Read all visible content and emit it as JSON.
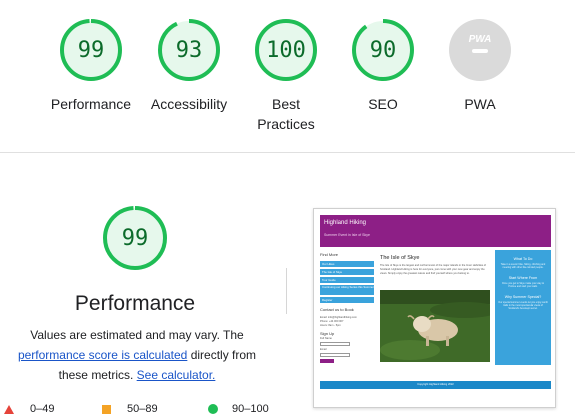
{
  "categories": [
    {
      "score": "99",
      "label": "Performance",
      "fraction": 0.99
    },
    {
      "score": "93",
      "label": "Accessibility",
      "fraction": 0.93
    },
    {
      "score": "100",
      "label": "Best Practices",
      "label_line1": "Best",
      "label_line2": "Practices",
      "fraction": 1.0
    },
    {
      "score": "90",
      "label": "SEO",
      "fraction": 0.9
    },
    {
      "score": "",
      "label": "PWA",
      "badge_text": "PWA"
    }
  ],
  "performance": {
    "score": "99",
    "fraction": 0.99,
    "title": "Performance",
    "desc_part1": "Values are estimated and may vary. The ",
    "desc_link1": "performance score is calculated",
    "desc_part2": " directly from these metrics. ",
    "desc_link2": "See calculator."
  },
  "legend": [
    {
      "range": "0–49",
      "shape": "triangle",
      "color": "#e5433a"
    },
    {
      "range": "50–89",
      "shape": "square",
      "color": "#f4a325"
    },
    {
      "range": "90–100",
      "shape": "circle",
      "color": "#1fbd55"
    }
  ],
  "colors": {
    "pass_ring": "#1fbd55",
    "pass_fill": "#e6f8ec",
    "pass_text": "#0c6b2b",
    "pwa_gray": "#dadada"
  },
  "thumbnail": {
    "site_title": "Highland Hiking",
    "site_subtitle": "Summer Event in Isle of Skye",
    "find_more": "Find More",
    "left_links": [
      "Our Hikes",
      "The Isle of Skye",
      "Tour Guide",
      "Continuing our Hiking Series this Summer",
      "Register"
    ],
    "contact_heading": "Contact us to Book",
    "contact_lines": [
      "Email: info@highlandhiking.com",
      "Phone: +44 000 007",
      "Hours: 8am - 5pm"
    ],
    "signup_heading": "Sign Up",
    "signup_fields": [
      "Full Name",
      "Email"
    ],
    "center_title": "The Isle of Skye",
    "center_para": "The Isle of Skye is the largest and northernmost of the major islands in the Inner Hebrides of Scotland. Highland Hiking is here for everyone, just come with your new gear and enjoy the views. Simply enjoy the greatest nature and find yourself where you belong to.",
    "right_sections": [
      {
        "heading": "What To Do",
        "text": "Take in a scenic hike, hiking, climbing and meeting with other like-minded people."
      },
      {
        "heading": "Start Where From",
        "text": "Once you get to Skye make your way to Portree and start your walk."
      },
      {
        "heading": "Why Summer Special?",
        "text": "Our special summer events let you enjoy sunlit trails in the most spectacular views of Scotland's best-kept secret."
      }
    ],
    "footer": "Copyright Highland Hiking 2022"
  }
}
